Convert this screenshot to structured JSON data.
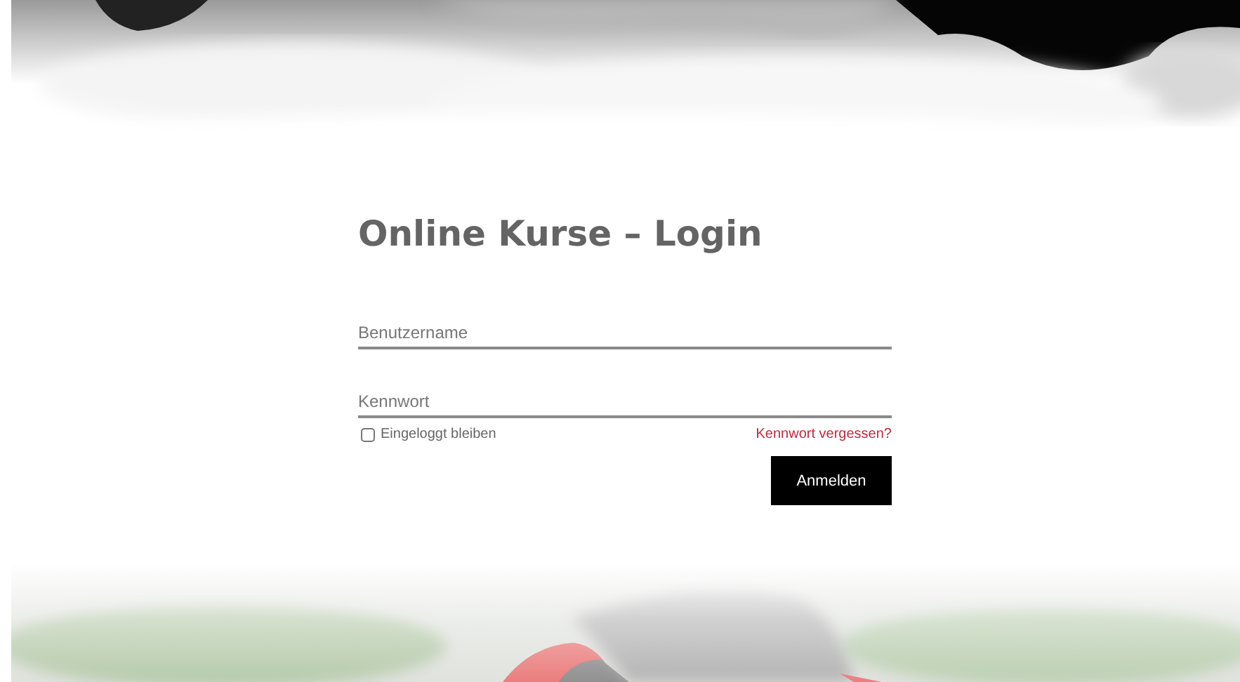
{
  "title": "Online Kurse – Login",
  "fields": [
    {
      "placeholder": "Benutzername"
    },
    {
      "placeholder": "Kennwort"
    }
  ],
  "remember": {
    "label": "Eingeloggt bleiben",
    "checked": false
  },
  "forgot_link": "Kennwort vergessen?",
  "submit_button": "Anmelden"
}
